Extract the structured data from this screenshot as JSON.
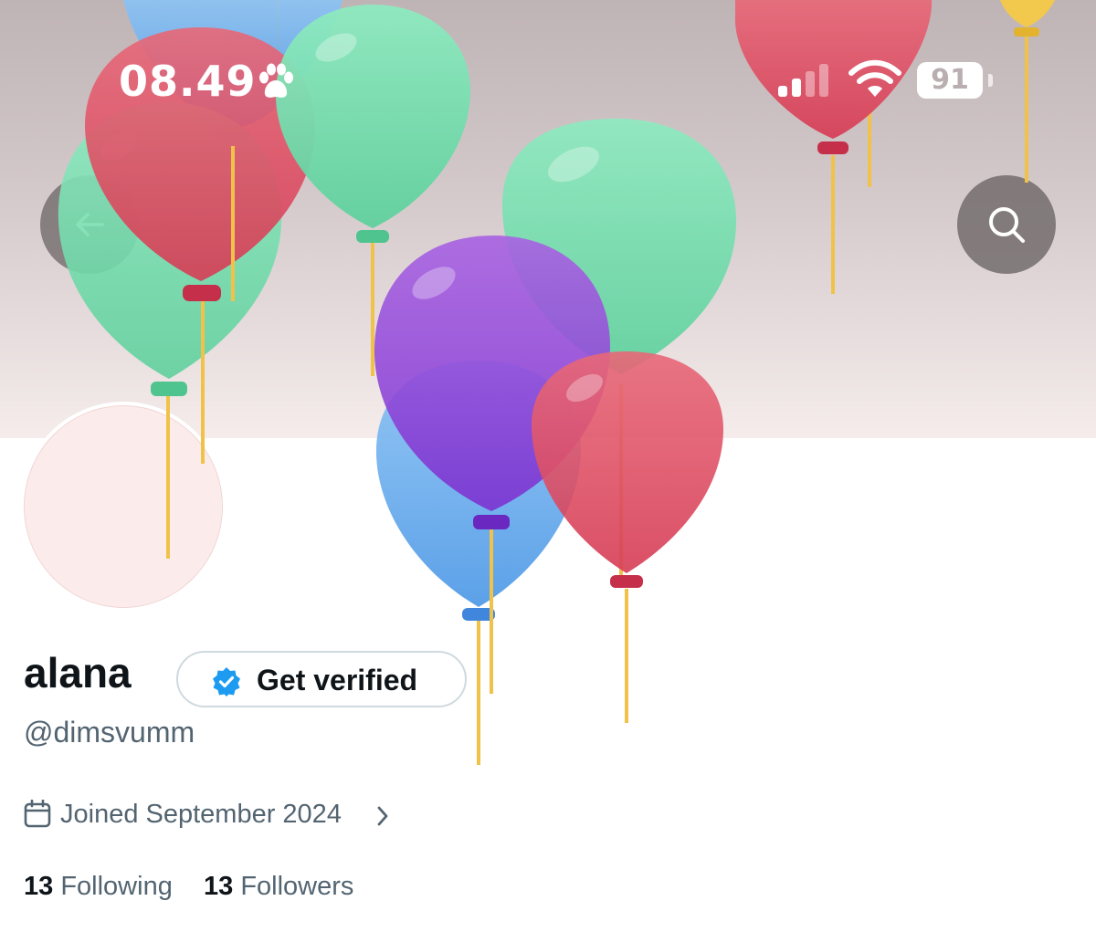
{
  "status_bar": {
    "time": "08.49",
    "battery_level": "91",
    "signal_bars_active": 2,
    "signal_bars_total": 4
  },
  "header": {
    "back_icon": "arrow-left-icon",
    "search_icon": "search-icon"
  },
  "profile": {
    "name": "alana",
    "verify_label": "Get verified",
    "handle": "@dimsvumm",
    "joined": "Joined September 2024",
    "following_count": "13",
    "following_label": "Following",
    "followers_count": "13",
    "followers_label": "Followers"
  },
  "colors": {
    "accent_blue": "#1d9bf0",
    "text_primary": "#0f1419",
    "text_secondary": "#536471",
    "balloon_red": "#e0485f",
    "balloon_green": "#6fdcaa",
    "balloon_blue": "#5aa3ec",
    "balloon_purple": "#8e44d8",
    "balloon_yellow": "#f2c94c"
  }
}
